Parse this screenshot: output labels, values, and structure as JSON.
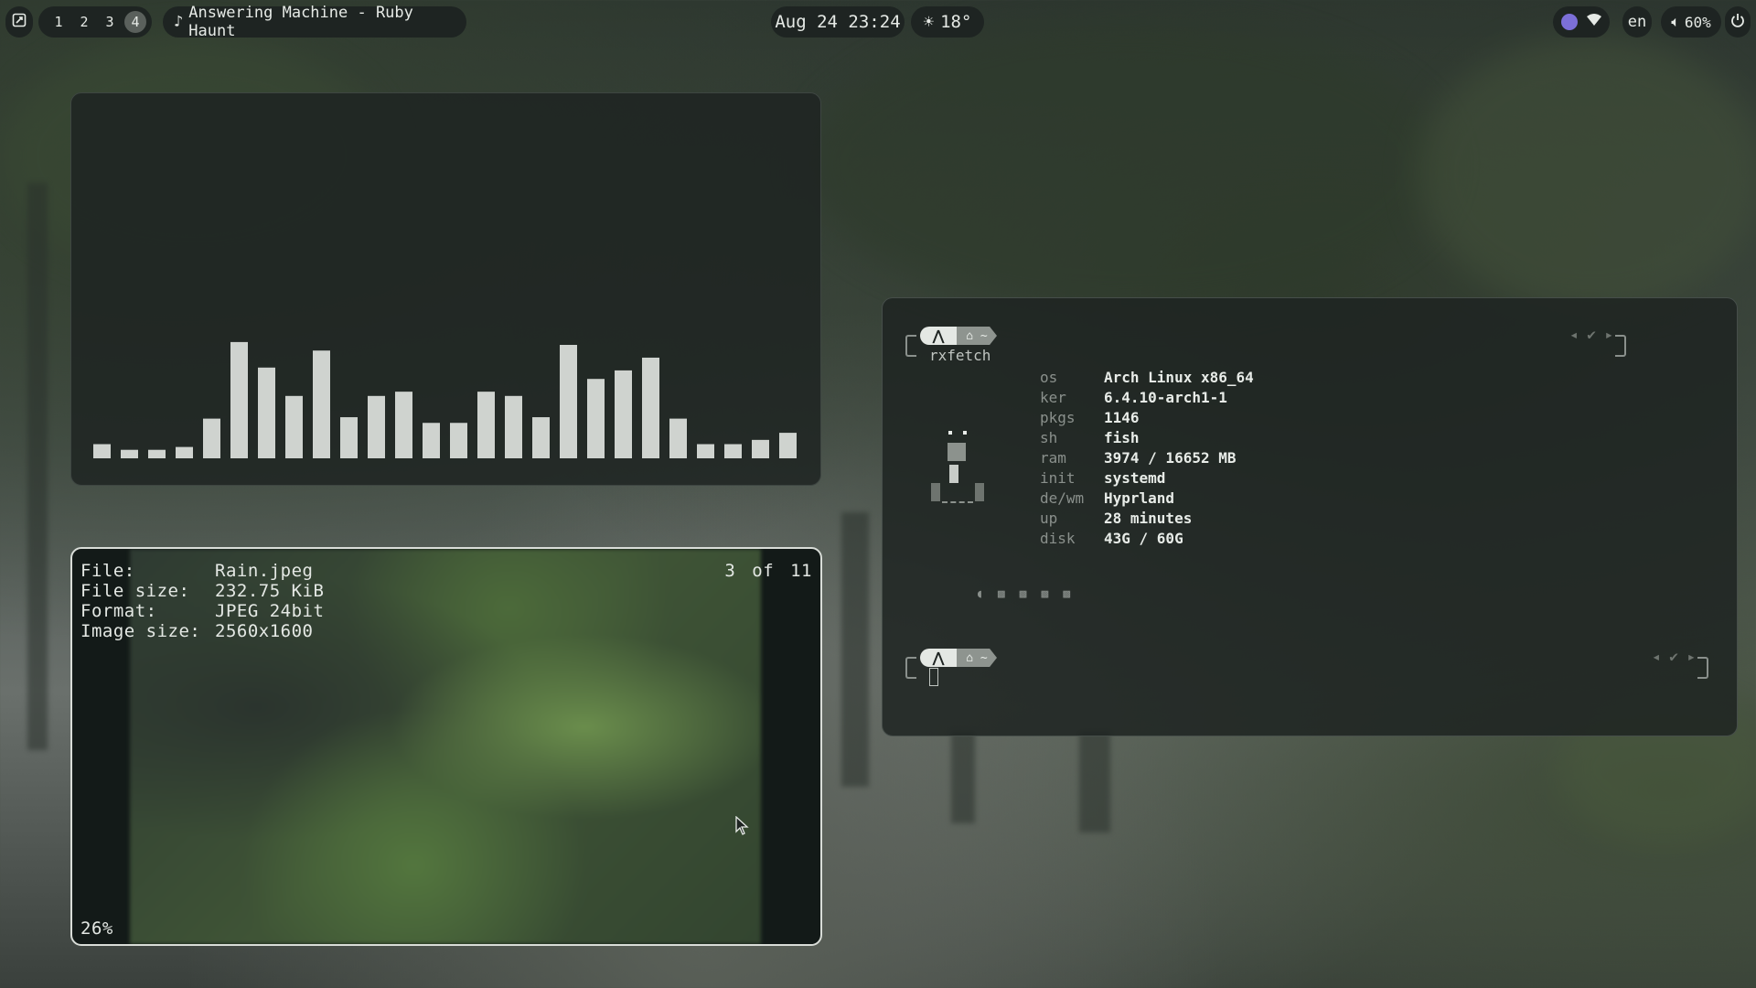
{
  "topbar": {
    "workspaces": [
      "1",
      "2",
      "3",
      "4"
    ],
    "active_workspace": "4",
    "media_title": "Answering Machine - Ruby Haunt",
    "datetime": "Aug 24 23:24",
    "weather": "18°",
    "language": "en",
    "volume": "60%",
    "icons": [
      "launcher-icon",
      "music-note-icon",
      "sun-icon",
      "avatar-icon",
      "wifi-icon",
      "speaker-icon",
      "power-icon"
    ]
  },
  "visualizer": {
    "bar_levels": [
      0.1,
      0.06,
      0.06,
      0.08,
      0.28,
      0.82,
      0.64,
      0.44,
      0.76,
      0.29,
      0.44,
      0.47,
      0.25,
      0.25,
      0.47,
      0.44,
      0.29,
      0.8,
      0.56,
      0.62,
      0.71,
      0.28,
      0.1,
      0.1,
      0.13,
      0.18
    ],
    "bar_color": "#cfd3cf"
  },
  "image_viewer": {
    "file_label": "File:",
    "file_value": "Rain.jpeg",
    "size_label": "File size:",
    "size_value": "232.75 KiB",
    "format_label": "Format:",
    "format_value": "JPEG 24bit",
    "dims_label": "Image size:",
    "dims_value": "2560x1600",
    "index": "3",
    "of": "of",
    "total": "11",
    "zoom": "26%"
  },
  "terminal": {
    "command": "rxfetch",
    "prompt_dir": "~",
    "info": [
      {
        "label": "os",
        "value": "Arch Linux x86_64"
      },
      {
        "label": "ker",
        "value": "6.4.10-arch1-1"
      },
      {
        "label": "pkgs",
        "value": "1146"
      },
      {
        "label": "sh",
        "value": "fish"
      },
      {
        "label": "ram",
        "value": "3974 / 16652 MB"
      },
      {
        "label": "init",
        "value": "systemd"
      },
      {
        "label": "de/wm",
        "value": "Hyprland"
      },
      {
        "label": "up",
        "value": "28 minutes"
      },
      {
        "label": "disk",
        "value": "43G / 60G"
      }
    ]
  }
}
